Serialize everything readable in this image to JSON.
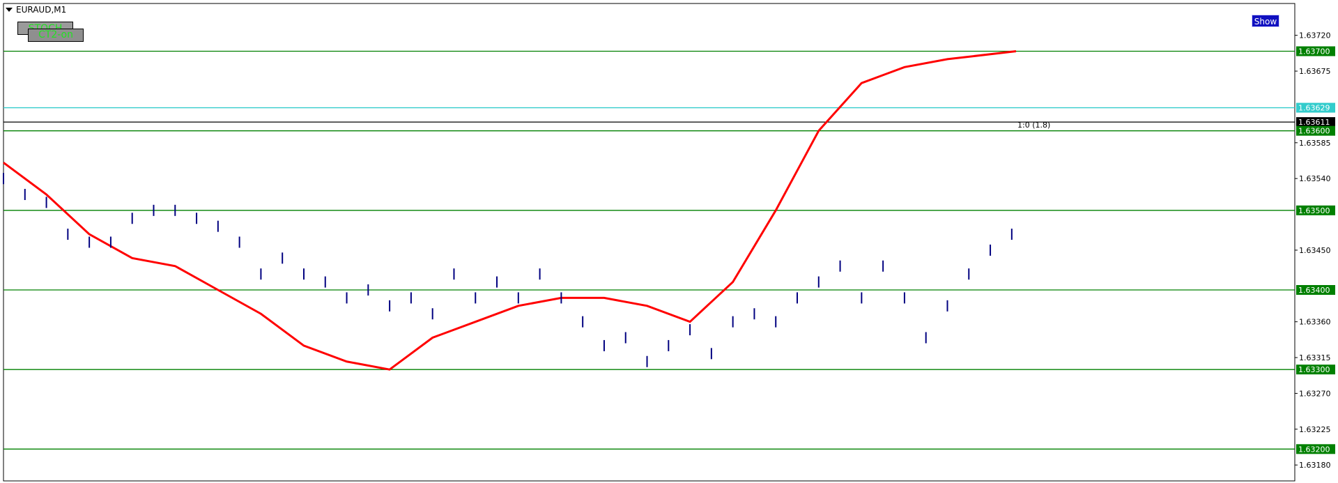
{
  "window": {
    "symbol": "EURAUD,M1"
  },
  "buttons": {
    "stoch": "STOCH",
    "ct2": "CT2-on",
    "show": "Show"
  },
  "annotation": "1:0 (1.8)",
  "colors": {
    "candle": "#000080",
    "sma_red": "#ff0000",
    "ema_blue": "#0000ff",
    "ma_brown": "#8b4513",
    "ma_teal": "#2f8f8f",
    "bands_black": "#000000",
    "env_magenta": "#ff00ff",
    "level_green": "#008000",
    "level_cyan": "#33cccc",
    "price_line": "#000000",
    "buy_arrow": "#00ff00",
    "sell_arrow": "#ff0000",
    "trend_blue": "#0000ff"
  },
  "chart_data": {
    "type": "line",
    "title": "EURAUD,M1",
    "ylim": [
      1.6316,
      1.6376
    ],
    "y_ticks": [
      "1.63720",
      "1.63675",
      "1.63585",
      "1.63540",
      "1.63450",
      "1.63360",
      "1.63315",
      "1.63270",
      "1.63225",
      "1.63180"
    ],
    "level_lines": [
      {
        "label": "1.63700",
        "value": 1.637,
        "color": "#008000"
      },
      {
        "label": "1.63629",
        "value": 1.63629,
        "color": "#33cccc"
      },
      {
        "label": "1.63611",
        "value": 1.63611,
        "color": "#000000",
        "current": true
      },
      {
        "label": "1.63600",
        "value": 1.636,
        "color": "#008000"
      },
      {
        "label": "1.63500",
        "value": 1.635,
        "color": "#008000"
      },
      {
        "label": "1.63400",
        "value": 1.634,
        "color": "#008000"
      },
      {
        "label": "1.63300",
        "value": 1.633,
        "color": "#008000"
      },
      {
        "label": "1.63200",
        "value": 1.632,
        "color": "#008000"
      }
    ],
    "x_bars": 236,
    "series": [
      {
        "key": "price",
        "kind": "candle_close",
        "points": [
          [
            0,
            1.6354
          ],
          [
            5,
            1.6352
          ],
          [
            10,
            1.6351
          ],
          [
            15,
            1.6347
          ],
          [
            20,
            1.6346
          ],
          [
            25,
            1.6346
          ],
          [
            30,
            1.6349
          ],
          [
            35,
            1.635
          ],
          [
            40,
            1.635
          ],
          [
            45,
            1.6349
          ],
          [
            50,
            1.6348
          ],
          [
            55,
            1.6346
          ],
          [
            60,
            1.6342
          ],
          [
            65,
            1.6344
          ],
          [
            70,
            1.6342
          ],
          [
            75,
            1.6341
          ],
          [
            80,
            1.6339
          ],
          [
            85,
            1.634
          ],
          [
            90,
            1.6338
          ],
          [
            95,
            1.6339
          ],
          [
            100,
            1.6337
          ],
          [
            105,
            1.6342
          ],
          [
            110,
            1.6339
          ],
          [
            115,
            1.6341
          ],
          [
            120,
            1.6339
          ],
          [
            125,
            1.6342
          ],
          [
            130,
            1.6339
          ],
          [
            135,
            1.6336
          ],
          [
            140,
            1.6333
          ],
          [
            145,
            1.6334
          ],
          [
            150,
            1.6331
          ],
          [
            155,
            1.6333
          ],
          [
            160,
            1.6335
          ],
          [
            165,
            1.6332
          ],
          [
            170,
            1.6336
          ],
          [
            175,
            1.6337
          ],
          [
            180,
            1.6336
          ],
          [
            185,
            1.6339
          ],
          [
            190,
            1.6341
          ],
          [
            195,
            1.6343
          ],
          [
            200,
            1.6339
          ],
          [
            205,
            1.6343
          ],
          [
            210,
            1.6339
          ],
          [
            215,
            1.6334
          ],
          [
            220,
            1.6338
          ],
          [
            225,
            1.6342
          ],
          [
            230,
            1.6345
          ],
          [
            235,
            1.6347
          ]
        ]
      },
      {
        "key": "sma_red_fast",
        "kind": "line",
        "color": "#ff0000",
        "points": [
          [
            0,
            1.6356
          ],
          [
            10,
            1.6352
          ],
          [
            20,
            1.6347
          ],
          [
            30,
            1.6344
          ],
          [
            40,
            1.6343
          ],
          [
            50,
            1.634
          ],
          [
            60,
            1.6337
          ],
          [
            70,
            1.6333
          ],
          [
            80,
            1.6331
          ],
          [
            90,
            1.633
          ],
          [
            100,
            1.6334
          ],
          [
            110,
            1.6336
          ],
          [
            120,
            1.6338
          ],
          [
            130,
            1.6339
          ],
          [
            140,
            1.6339
          ],
          [
            150,
            1.6338
          ],
          [
            160,
            1.6336
          ],
          [
            170,
            1.6341
          ],
          [
            180,
            1.635
          ],
          [
            190,
            1.636
          ],
          [
            200,
            1.6366
          ],
          [
            210,
            1.6368
          ],
          [
            220,
            1.6369
          ],
          [
            236,
            1.637
          ]
        ]
      }
    ]
  }
}
